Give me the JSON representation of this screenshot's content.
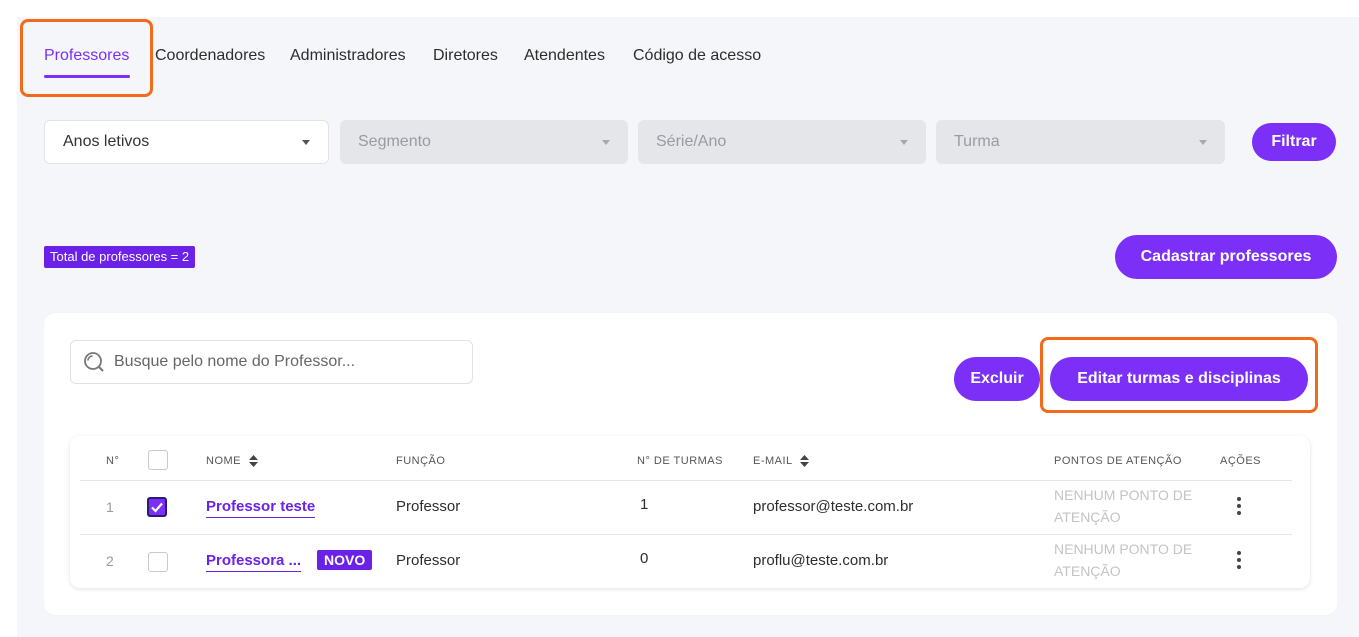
{
  "tabs": [
    {
      "label": "Professores",
      "active": true
    },
    {
      "label": "Coordenadores",
      "active": false
    },
    {
      "label": "Administradores",
      "active": false
    },
    {
      "label": "Diretores",
      "active": false
    },
    {
      "label": "Atendentes",
      "active": false
    },
    {
      "label": "Código de acesso",
      "active": false
    }
  ],
  "filters": {
    "anos_letivos": "Anos letivos",
    "segmento": "Segmento",
    "serie_ano": "Série/Ano",
    "turma": "Turma",
    "filter_button": "Filtrar"
  },
  "total_badge": "Total de professores = 2",
  "register_button": "Cadastrar professores",
  "search": {
    "placeholder": "Busque pelo nome do Professor..."
  },
  "actions": {
    "delete_button": "Excluir",
    "edit_button": "Editar turmas e disciplinas"
  },
  "table": {
    "headers": {
      "num": "N°",
      "name": "NOME",
      "role": "FUNÇÃO",
      "classes": "N° DE TURMAS",
      "email": "E-MAIL",
      "attention": "PONTOS DE ATENÇÃO",
      "actions": "AÇÕES"
    },
    "rows": [
      {
        "num": "1",
        "checked": true,
        "name": "Professor teste",
        "badge": "",
        "role": "Professor",
        "classes": "1",
        "email": "professor@teste.com.br",
        "attention": "NENHUM PONTO DE ATENÇÃO"
      },
      {
        "num": "2",
        "checked": false,
        "name": "Professora ...",
        "badge": "NOVO",
        "role": "Professor",
        "classes": "0",
        "email": "proflu@teste.com.br",
        "attention": "NENHUM PONTO DE ATENÇÃO"
      }
    ]
  },
  "colors": {
    "accent": "#7b2ff7",
    "highlight": "#f26a1b"
  }
}
